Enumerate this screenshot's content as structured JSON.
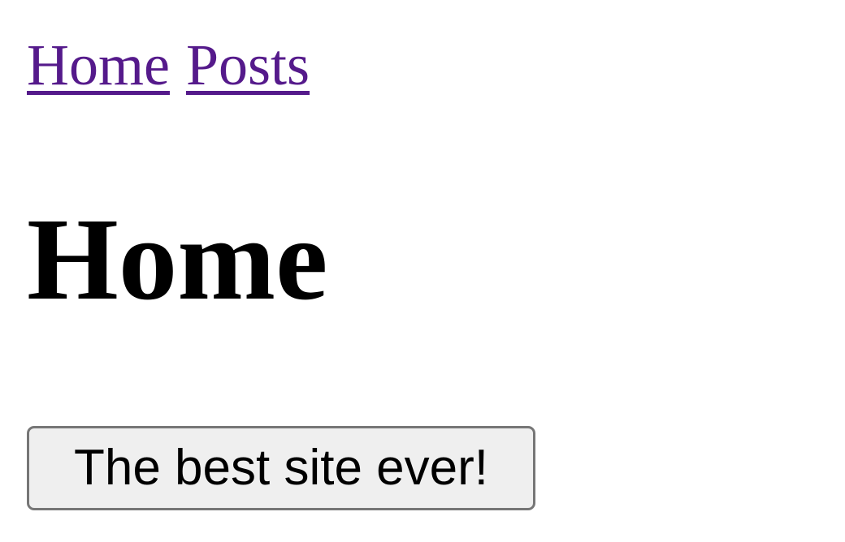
{
  "nav": {
    "links": [
      {
        "label": "Home"
      },
      {
        "label": "Posts"
      }
    ]
  },
  "main": {
    "heading": "Home",
    "button_label": "The best site ever!"
  },
  "colors": {
    "link": "#551a8b",
    "text": "#000000",
    "button_bg": "#efefef",
    "button_border": "#767676",
    "page_bg": "#ffffff"
  }
}
